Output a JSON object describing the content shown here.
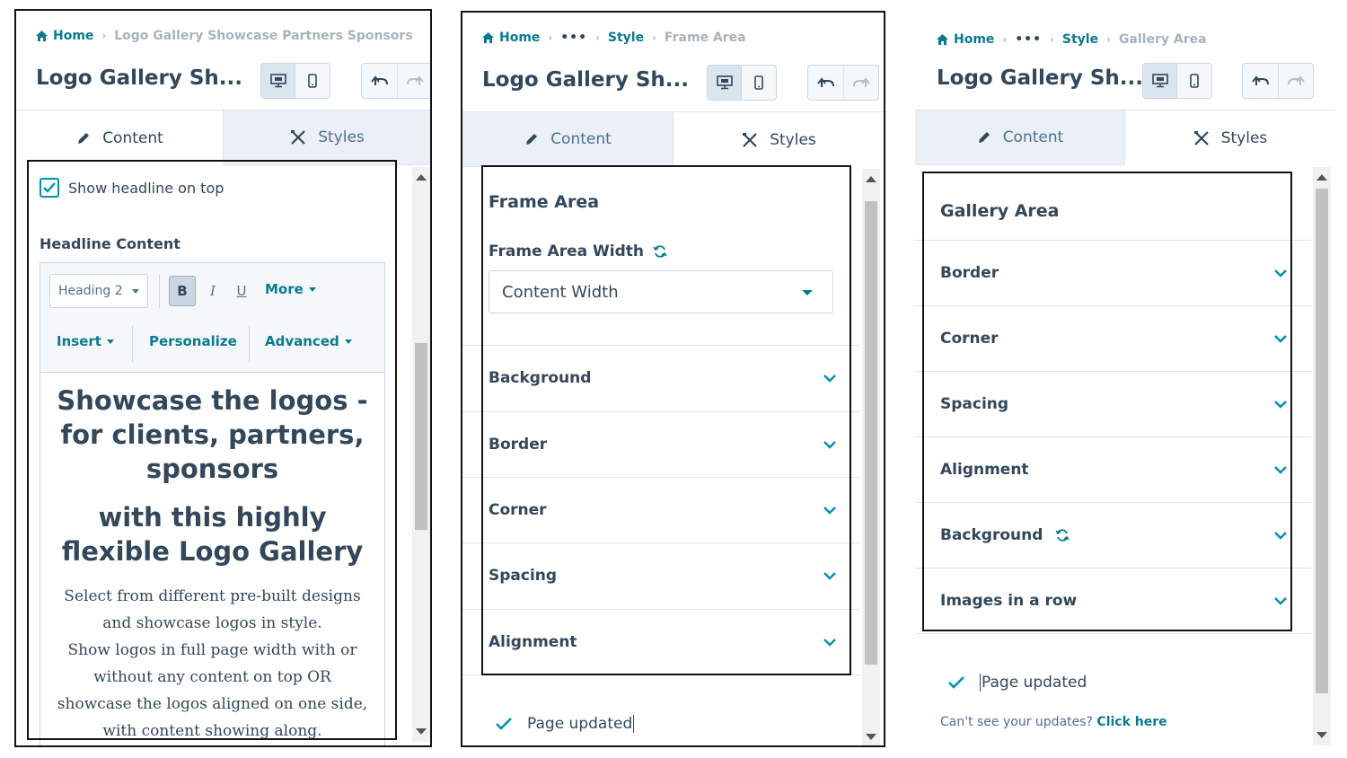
{
  "panel1": {
    "breadcrumb": {
      "home": "Home",
      "current": "Logo Gallery Showcase Partners Sponsors"
    },
    "title": "Logo Gallery Sh...",
    "tabs": {
      "content": "Content",
      "styles": "Styles"
    },
    "show_headline_label": "Show headline on top",
    "headline_content_label": "Headline Content",
    "toolbar": {
      "heading_select": "Heading 2",
      "bold": "B",
      "italic": "I",
      "underline": "U",
      "more": "More",
      "insert": "Insert",
      "personalize": "Personalize",
      "advanced": "Advanced"
    },
    "doc": {
      "h1": "Showcase the logos - for clients, partners, sponsors",
      "h2": "with this highly flexible Logo Gallery",
      "p1": "Select from different pre-built designs and showcase logos in style.",
      "p2": "Show logos in full page width with or without any content on top OR",
      "p3": "showcase the logos aligned  on one side, with content showing along."
    }
  },
  "panel2": {
    "breadcrumb": {
      "home": "Home",
      "ellipsis": "•••",
      "style": "Style",
      "current": "Frame Area"
    },
    "title": "Logo Gallery Sh...",
    "tabs": {
      "content": "Content",
      "styles": "Styles"
    },
    "section_title": "Frame Area",
    "width_label": "Frame Area Width",
    "width_value": "Content Width",
    "rows": [
      "Background",
      "Border",
      "Corner",
      "Spacing",
      "Alignment"
    ],
    "status": "Page updated"
  },
  "panel3": {
    "breadcrumb": {
      "home": "Home",
      "ellipsis": "•••",
      "style": "Style",
      "current": "Gallery Area"
    },
    "title": "Logo Gallery Sh...",
    "tabs": {
      "content": "Content",
      "styles": "Styles"
    },
    "section_title": "Gallery Area",
    "rows": [
      "Border",
      "Corner",
      "Spacing",
      "Alignment",
      "Background",
      "Images in a row"
    ],
    "status": "Page updated",
    "hint_text": "Can't see your updates?",
    "hint_link": "Click here"
  },
  "colors": {
    "accent": "#0b7a8f",
    "text": "#33475b",
    "muted": "#a9b2bb"
  }
}
